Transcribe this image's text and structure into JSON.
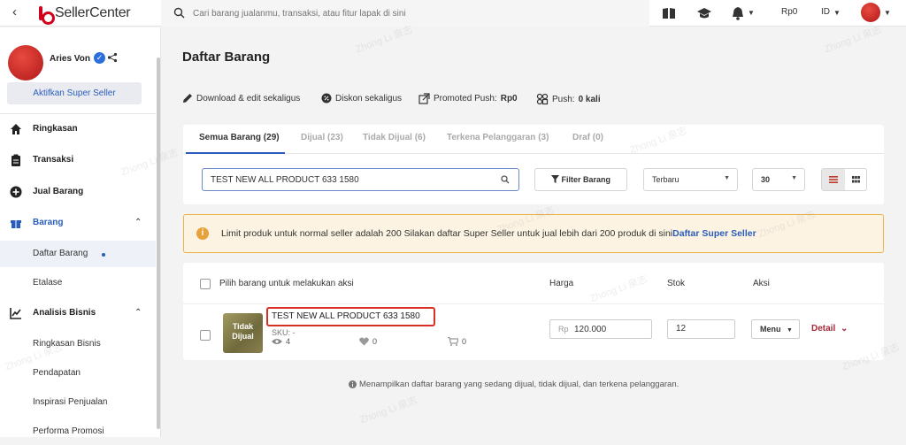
{
  "topbar": {
    "brand": "SellerCenter",
    "search_placeholder": "Cari barang jualanmu, transaksi, atau fitur lapak di sini",
    "balance": "Rp0",
    "language": "ID"
  },
  "sidebar": {
    "user_name": "Aries Von",
    "super_seller_button": "Aktifkan Super Seller",
    "nav": {
      "ringkasan": "Ringkasan",
      "transaksi": "Transaksi",
      "jual_barang": "Jual Barang",
      "barang": "Barang",
      "daftar_barang": "Daftar Barang",
      "etalase": "Etalase",
      "analisis_bisnis": "Analisis Bisnis",
      "ringkasan_bisnis": "Ringkasan Bisnis",
      "pendapatan": "Pendapatan",
      "inspirasi_penjualan": "Inspirasi Penjualan",
      "performa_promosi": "Performa Promosi"
    }
  },
  "main": {
    "title": "Daftar Barang",
    "actions": {
      "download_edit": "Download & edit sekaligus",
      "diskon": "Diskon sekaligus",
      "promoted_label": "Promoted Push:",
      "promoted_value": "Rp0",
      "push_label": "Push:",
      "push_value": "0 kali"
    },
    "tabs": [
      {
        "label": "Semua Barang (29)"
      },
      {
        "label": "Dijual (23)"
      },
      {
        "label": "Tidak Dijual (6)"
      },
      {
        "label": "Terkena Pelanggaran (3)"
      },
      {
        "label": "Draf (0)"
      }
    ],
    "search_value": "TEST NEW ALL PRODUCT 633 1580",
    "filter_button": "Filter Barang",
    "sort_value": "Terbaru",
    "per_page_value": "30",
    "alert": {
      "text": "Limit produk untuk normal seller adalah 200 Silakan daftar Super Seller untuk jual lebih dari 200 produk di sini",
      "link": "Daftar Super Seller"
    },
    "table": {
      "headers": {
        "select_all": "Pilih barang untuk melakukan aksi",
        "price": "Harga",
        "stock": "Stok",
        "action": "Aksi"
      },
      "rows": [
        {
          "status_overlay": "Tidak Dijual",
          "name": "TEST NEW ALL PRODUCT 633 1580",
          "sku": "SKU: -",
          "views": "4",
          "likes": "0",
          "carts": "0",
          "currency": "Rp",
          "price": "120.000",
          "stock": "12",
          "menu_label": "Menu",
          "detail_label": "Detail"
        }
      ]
    },
    "footnote": "Menampilkan daftar barang yang sedang dijual, tidak dijual, dan terkena pelanggaran."
  },
  "watermark": "Zhong Li 泉志"
}
